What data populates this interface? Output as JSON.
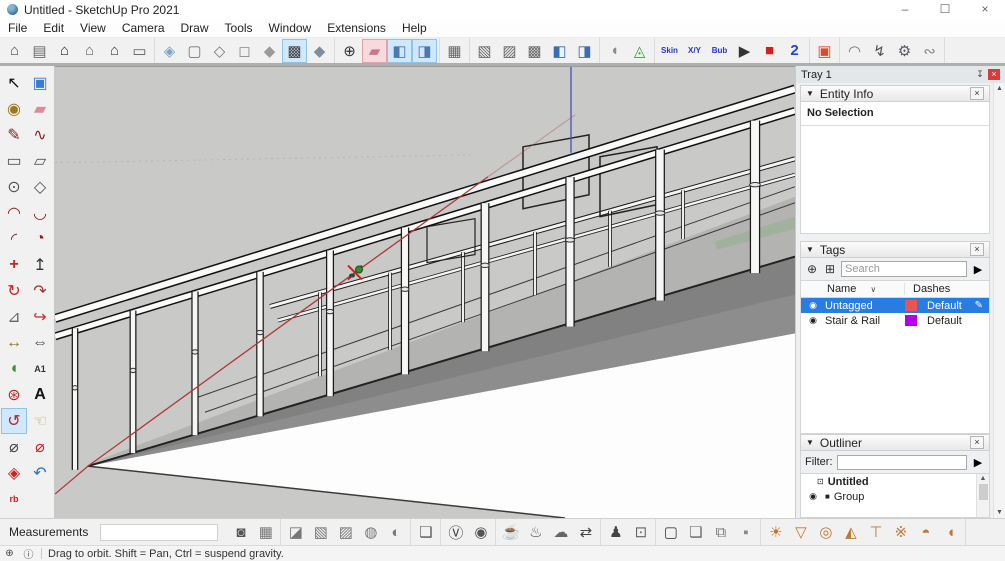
{
  "window": {
    "title": "Untitled - SketchUp Pro 2021",
    "controls": {
      "minimize": "–",
      "maximize": "☐",
      "close": "×"
    }
  },
  "menu": {
    "items": [
      "File",
      "Edit",
      "View",
      "Camera",
      "Draw",
      "Tools",
      "Window",
      "Extensions",
      "Help"
    ]
  },
  "top_toolbar": {
    "groups": [
      {
        "name": "views",
        "icons": [
          {
            "name": "iso-view-icon",
            "glyph": "⌂",
            "color": "#4d4d4d"
          },
          {
            "name": "top-view-icon",
            "glyph": "▤",
            "color": "#6a6a6a"
          },
          {
            "name": "front-view-icon",
            "glyph": "⌂",
            "color": "#2e2e2e"
          },
          {
            "name": "right-view-icon",
            "glyph": "⌂",
            "color": "#6a6a6a"
          },
          {
            "name": "back-view-icon",
            "glyph": "⌂",
            "color": "#3c3c3c"
          },
          {
            "name": "left-view-icon",
            "glyph": "▭",
            "color": "#5a5a5a"
          }
        ]
      },
      {
        "name": "styles",
        "icons": [
          {
            "name": "xray-style-icon",
            "glyph": "◈",
            "color": "#7aa3c4"
          },
          {
            "name": "back-edges-style-icon",
            "glyph": "▢",
            "color": "#777777"
          },
          {
            "name": "wireframe-style-icon",
            "glyph": "◇",
            "color": "#777777"
          },
          {
            "name": "hidden-line-style-icon",
            "glyph": "◻",
            "color": "#888888"
          },
          {
            "name": "shaded-style-icon",
            "glyph": "◆",
            "color": "#9a9a9a"
          },
          {
            "name": "shaded-textures-style-icon",
            "glyph": "▩",
            "color": "#3f3f3f",
            "selected": true
          },
          {
            "name": "monochrome-style-icon",
            "glyph": "◆",
            "color": "#7e8ea0"
          }
        ]
      },
      {
        "name": "section",
        "icons": [
          {
            "name": "show-axes-icon",
            "glyph": "⊕",
            "color": "#333333"
          },
          {
            "name": "section-plane-icon",
            "glyph": "▰",
            "color": "#cc7788",
            "selected_pink": true
          },
          {
            "name": "section-cuts-icon",
            "glyph": "◧",
            "color": "#4a78b0",
            "selected": true
          },
          {
            "name": "section-fill-icon",
            "glyph": "◨",
            "color": "#4a78b0",
            "selected": true
          }
        ]
      },
      {
        "name": "component-single",
        "icons": [
          {
            "name": "component-cube-icon",
            "glyph": "▦",
            "color": "#666666"
          }
        ]
      },
      {
        "name": "component-tools",
        "icons": [
          {
            "name": "cube-tool-1-icon",
            "glyph": "▧",
            "color": "#666666"
          },
          {
            "name": "cube-tool-2-icon",
            "glyph": "▨",
            "color": "#666666"
          },
          {
            "name": "cube-tool-3-icon",
            "glyph": "▩",
            "color": "#666666"
          },
          {
            "name": "cube-tool-4-icon",
            "glyph": "◧",
            "color": "#3a6db5"
          },
          {
            "name": "cube-tool-5-icon",
            "glyph": "◨",
            "color": "#3a6db5"
          }
        ]
      },
      {
        "name": "shell-tools",
        "icons": [
          {
            "name": "shell-icon",
            "glyph": "◖",
            "color": "#8a8a8a"
          },
          {
            "name": "geodesic-icon",
            "glyph": "◬",
            "color": "#3f9b3f"
          }
        ]
      },
      {
        "name": "soap-skin-bubble",
        "icons": [
          {
            "name": "skin-tool-icon",
            "glyph": "Skin",
            "text": true
          },
          {
            "name": "xy-tool-icon",
            "glyph": "X/Y",
            "text": true
          },
          {
            "name": "bubble-tool-icon",
            "glyph": "Bub",
            "text": true
          },
          {
            "name": "play-icon",
            "glyph": "▶",
            "color": "#333333"
          },
          {
            "name": "stop-icon",
            "glyph": "■",
            "color": "#cc2222"
          },
          {
            "name": "step-2-icon",
            "glyph": "2",
            "color": "#2244cc",
            "bold": true
          }
        ]
      },
      {
        "name": "red-component",
        "icons": [
          {
            "name": "red-box-icon",
            "glyph": "▣",
            "color": "#e04a22"
          }
        ]
      },
      {
        "name": "extensions-extra",
        "icons": [
          {
            "name": "curviloft-icon",
            "glyph": "◠",
            "color": "#707070"
          },
          {
            "name": "zigzag-icon",
            "glyph": "↯",
            "color": "#555555"
          },
          {
            "name": "tool-inspector-icon",
            "glyph": "⚙",
            "color": "#555566"
          },
          {
            "name": "edge-partial-icon",
            "glyph": "∾",
            "color": "#888888"
          }
        ]
      }
    ]
  },
  "left_toolbar": {
    "tools": [
      {
        "name": "select-tool",
        "glyph": "↖",
        "color": "#111111"
      },
      {
        "name": "make-component-tool",
        "glyph": "▣",
        "color": "#3a7bd5"
      },
      {
        "name": "paint-bucket-tool",
        "glyph": "◉",
        "color": "#a07818"
      },
      {
        "name": "eraser-tool",
        "glyph": "▰",
        "color": "#e08898"
      },
      {
        "name": "line-tool",
        "glyph": "✎",
        "color": "#8b2020"
      },
      {
        "name": "freehand-tool",
        "glyph": "∿",
        "color": "#8b2020"
      },
      {
        "name": "rectangle-tool",
        "glyph": "▭",
        "color": "#555555"
      },
      {
        "name": "rotated-rectangle-tool",
        "glyph": "▱",
        "color": "#555555"
      },
      {
        "name": "circle-tool",
        "glyph": "⊙",
        "color": "#555555"
      },
      {
        "name": "polygon-tool",
        "glyph": "◇",
        "color": "#555555"
      },
      {
        "name": "arc-tool",
        "glyph": "◠",
        "color": "#8b2020"
      },
      {
        "name": "two-point-arc-tool",
        "glyph": "◡",
        "color": "#8b2020"
      },
      {
        "name": "three-point-arc-tool",
        "glyph": "◜",
        "color": "#8b2020"
      },
      {
        "name": "pie-tool",
        "glyph": "◔",
        "color": "#8b2020"
      },
      {
        "name": "move-tool",
        "glyph": "+",
        "color": "#cc2222",
        "bold": true
      },
      {
        "name": "push-pull-tool",
        "glyph": "↥",
        "color": "#333333"
      },
      {
        "name": "rotate-tool",
        "glyph": "↻",
        "color": "#cc2222"
      },
      {
        "name": "follow-me-tool",
        "glyph": "↷",
        "color": "#993333"
      },
      {
        "name": "scale-tool",
        "glyph": "⊿",
        "color": "#666666"
      },
      {
        "name": "offset-tool",
        "glyph": "↪",
        "color": "#bb3333"
      },
      {
        "name": "tape-measure-tool",
        "glyph": "↔",
        "color": "#8a7a10"
      },
      {
        "name": "dimension-tool",
        "glyph": "⇔",
        "color": "#444444"
      },
      {
        "name": "protractor-tool",
        "glyph": "◖",
        "color": "#3f8f3f"
      },
      {
        "name": "text-tool",
        "glyph": "A1",
        "small": true,
        "color": "#333333"
      },
      {
        "name": "axes-tool",
        "glyph": "⊛",
        "color": "#cc2222"
      },
      {
        "name": "3d-text-tool",
        "glyph": "A",
        "color": "#111111",
        "bold": true
      },
      {
        "name": "orbit-tool",
        "glyph": "↺",
        "color": "#bb2222",
        "selected": true
      },
      {
        "name": "pan-tool",
        "glyph": "☜",
        "color": "#c9a86a"
      },
      {
        "name": "zoom-tool",
        "glyph": "⌀",
        "color": "#444444"
      },
      {
        "name": "zoom-window-tool",
        "glyph": "⌀",
        "color": "#cc2222"
      },
      {
        "name": "zoom-extents-tool",
        "glyph": "◈",
        "color": "#cc2222"
      },
      {
        "name": "previous-view-tool",
        "glyph": "↶",
        "color": "#2a6fc0"
      },
      {
        "name": "rb-plugin-tool",
        "glyph": "rb",
        "small": true,
        "color": "#cc2222"
      }
    ]
  },
  "viewport": {
    "colors": {
      "background": "#c9c9c8",
      "ramp": "#8d8d8d",
      "walkway": "#b3b3b1",
      "face": "#fdfdfd",
      "red_axis": "#b23737",
      "blue_axis": "#4d4dc0",
      "green_origin": "#2e8f2e"
    }
  },
  "tray": {
    "title": "Tray 1",
    "entity_info": {
      "title": "Entity Info",
      "body": "No Selection"
    },
    "tags": {
      "title": "Tags",
      "search_placeholder": "Search",
      "columns": {
        "name": "Name",
        "dashes": "Dashes"
      },
      "rows": [
        {
          "name": "Untagged",
          "dashes": "Default",
          "color": "#ef5252",
          "selected": true
        },
        {
          "name": "Stair & Rail",
          "dashes": "Default",
          "color": "#b200e8",
          "selected": false
        }
      ]
    },
    "outliner": {
      "title": "Outliner",
      "filter_label": "Filter:",
      "items": [
        {
          "label": "Untitled",
          "bold": true,
          "icon": "model"
        },
        {
          "label": "Group",
          "bold": false,
          "icon": "group"
        }
      ]
    }
  },
  "bottom_toolbar": {
    "measurements_label": "Measurements",
    "measurements_value": "",
    "groups": [
      {
        "name": "vray-objects",
        "icons": [
          {
            "name": "override-material-icon",
            "glyph": "◙",
            "color": "#555555"
          },
          {
            "name": "displacement-cube-icon",
            "glyph": "▦",
            "color": "#777777"
          }
        ]
      },
      {
        "name": "render-styles",
        "icons": [
          {
            "name": "split-square-icon",
            "glyph": "◪",
            "color": "#777777"
          },
          {
            "name": "texture-cube-1-icon",
            "glyph": "▧",
            "color": "#777777"
          },
          {
            "name": "texture-cube-2-icon",
            "glyph": "▨",
            "color": "#777777"
          },
          {
            "name": "dotted-sphere-icon",
            "glyph": "◍",
            "color": "#777777"
          },
          {
            "name": "half-sphere-icon",
            "glyph": "◐",
            "color": "#777777"
          }
        ]
      },
      {
        "name": "pick-object",
        "icons": [
          {
            "name": "select-rendered-object-icon",
            "glyph": "❏",
            "color": "#555555"
          }
        ]
      },
      {
        "name": "vray-main",
        "icons": [
          {
            "name": "vray-asset-editor-icon",
            "glyph": "Ⓥ",
            "color": "#444444"
          },
          {
            "name": "vray-color-picker-icon",
            "glyph": "◉",
            "color": "#555555"
          }
        ]
      },
      {
        "name": "vray-render",
        "icons": [
          {
            "name": "render-icon",
            "glyph": "☕",
            "color": "#444444"
          },
          {
            "name": "interactive-render-icon",
            "glyph": "♨",
            "color": "#555555"
          },
          {
            "name": "cloud-render-icon",
            "glyph": "☁",
            "color": "#666666"
          },
          {
            "name": "resume-render-icon",
            "glyph": "⇄",
            "color": "#444444"
          }
        ]
      },
      {
        "name": "vray-batch",
        "icons": [
          {
            "name": "batch-render-icon",
            "glyph": "♟",
            "color": "#444444"
          },
          {
            "name": "region-render-icon",
            "glyph": "⊡",
            "color": "#666666"
          }
        ]
      },
      {
        "name": "frame-buffer",
        "icons": [
          {
            "name": "frame-buffer-window-icon",
            "glyph": "▢",
            "color": "#444444"
          },
          {
            "name": "render-history-icon",
            "glyph": "❏",
            "color": "#666666"
          },
          {
            "name": "vfb-channels-icon",
            "glyph": "⧉",
            "color": "#777777"
          },
          {
            "name": "lock-frame-icon",
            "glyph": "▪",
            "color": "#888888"
          }
        ]
      },
      {
        "name": "vray-lights",
        "icons": [
          {
            "name": "sun-light-icon",
            "glyph": "☀",
            "color": "#c07830"
          },
          {
            "name": "spot-light-icon",
            "glyph": "▽",
            "color": "#c07830"
          },
          {
            "name": "omni-light-icon",
            "glyph": "◎",
            "color": "#c07830"
          },
          {
            "name": "rectangle-light-icon",
            "glyph": "◭",
            "color": "#c07830"
          },
          {
            "name": "ies-light-icon",
            "glyph": "⊤",
            "color": "#c07830"
          },
          {
            "name": "point-light-icon",
            "glyph": "※",
            "color": "#c07830"
          },
          {
            "name": "dome-light-icon",
            "glyph": "◓",
            "color": "#c07830"
          },
          {
            "name": "sphere-light-icon",
            "glyph": "◖",
            "color": "#c07830"
          }
        ]
      }
    ]
  },
  "status_bar": {
    "geolocation_icon": "⊕",
    "info_icon": "ⓘ",
    "text": "Drag to orbit. Shift = Pan, Ctrl = suspend gravity."
  }
}
